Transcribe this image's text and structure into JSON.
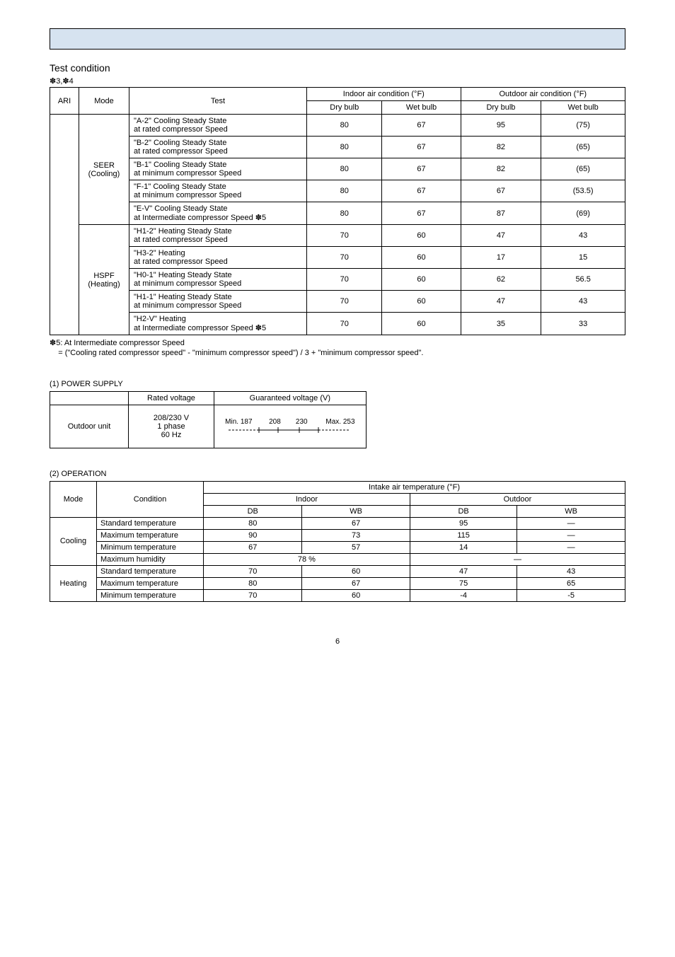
{
  "section_title": "Test condition",
  "note_top": "✽3,✽4",
  "table1": {
    "headers": {
      "ari": "ARI",
      "mode": "Mode",
      "test": "Test",
      "indoor": "Indoor air condition (°F)",
      "outdoor": "Outdoor air condition (°F)",
      "dry": "Dry bulb",
      "wet": "Wet bulb"
    },
    "seer_label": "SEER (Cooling)",
    "hspf_label": "HSPF (Heating)",
    "seer_rows": [
      {
        "test": "\"A-2\" Cooling Steady State\nat rated compressor Speed",
        "id": "80",
        "iw": "67",
        "od": "95",
        "ow": "(75)"
      },
      {
        "test": "\"B-2\" Cooling Steady State\nat rated compressor Speed",
        "id": "80",
        "iw": "67",
        "od": "82",
        "ow": "(65)"
      },
      {
        "test": "\"B-1\" Cooling Steady State\nat minimum compressor Speed",
        "id": "80",
        "iw": "67",
        "od": "82",
        "ow": "(65)"
      },
      {
        "test": "\"F-1\" Cooling Steady State\nat minimum compressor Speed",
        "id": "80",
        "iw": "67",
        "od": "67",
        "ow": "(53.5)"
      },
      {
        "test": "\"E-V\" Cooling Steady State\nat Intermediate compressor Speed ✽5",
        "id": "80",
        "iw": "67",
        "od": "87",
        "ow": "(69)"
      }
    ],
    "hspf_rows": [
      {
        "test": "\"H1-2\" Heating Steady State\nat rated compressor Speed",
        "id": "70",
        "iw": "60",
        "od": "47",
        "ow": "43"
      },
      {
        "test": "\"H3-2\" Heating\nat rated compressor Speed",
        "id": "70",
        "iw": "60",
        "od": "17",
        "ow": "15"
      },
      {
        "test": "\"H0-1\" Heating Steady State\nat minimum compressor Speed",
        "id": "70",
        "iw": "60",
        "od": "62",
        "ow": "56.5"
      },
      {
        "test": "\"H1-1\" Heating Steady State\nat minimum compressor Speed",
        "id": "70",
        "iw": "60",
        "od": "47",
        "ow": "43"
      },
      {
        "test": "\"H2-V\" Heating\nat Intermediate compressor Speed ✽5",
        "id": "70",
        "iw": "60",
        "od": "35",
        "ow": "33"
      }
    ]
  },
  "footnote": {
    "line1": "✽5: At Intermediate compressor Speed",
    "line2": "= (\"Cooling rated compressor speed\" - \"minimum compressor speed\") / 3 + \"minimum compressor speed\"."
  },
  "power": {
    "title": "(1) POWER SUPPLY",
    "rated_h": "Rated voltage",
    "guar_h": "Guaranteed voltage (V)",
    "unit": "Outdoor unit",
    "rated_v": "208/230 V\n1 phase\n60 Hz",
    "min_l": "Min. 187",
    "v208": "208",
    "v230": "230",
    "max_l": "Max. 253"
  },
  "operation": {
    "title": "(2) OPERATION",
    "mode_h": "Mode",
    "cond_h": "Condition",
    "intake_h": "Intake air temperature (°F)",
    "indoor_h": "Indoor",
    "outdoor_h": "Outdoor",
    "db": "DB",
    "wb": "WB",
    "cooling": "Cooling",
    "heating": "Heating",
    "dash": "—",
    "rows_cooling": [
      {
        "c": "Standard temperature",
        "idb": "80",
        "iwb": "67",
        "odb": "95",
        "owb": "—"
      },
      {
        "c": "Maximum temperature",
        "idb": "90",
        "iwb": "73",
        "odb": "115",
        "owb": "—"
      },
      {
        "c": "Minimum temperature",
        "idb": "67",
        "iwb": "57",
        "odb": "14",
        "owb": "—"
      }
    ],
    "humidity": {
      "c": "Maximum humidity",
      "val": "78 %",
      "right": "—"
    },
    "rows_heating": [
      {
        "c": "Standard temperature",
        "idb": "70",
        "iwb": "60",
        "odb": "47",
        "owb": "43"
      },
      {
        "c": "Maximum temperature",
        "idb": "80",
        "iwb": "67",
        "odb": "75",
        "owb": "65"
      },
      {
        "c": "Minimum temperature",
        "idb": "70",
        "iwb": "60",
        "odb": "-4",
        "owb": "-5"
      }
    ]
  },
  "page_num": "6"
}
